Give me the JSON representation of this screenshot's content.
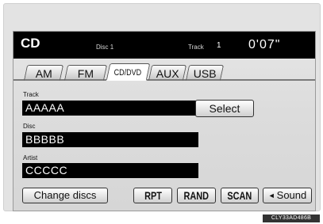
{
  "header": {
    "source": "CD",
    "disc_label": "Disc 1",
    "track_label": "Track",
    "track_number": "1",
    "elapsed_time": "0'07\""
  },
  "tabs": [
    {
      "label": "AM",
      "active": false
    },
    {
      "label": "FM",
      "active": false
    },
    {
      "label": "CD/DVD",
      "active": true
    },
    {
      "label": "AUX",
      "active": false
    },
    {
      "label": "USB",
      "active": false
    }
  ],
  "fields": {
    "track": {
      "label": "Track",
      "value": "AAAAA"
    },
    "disc": {
      "label": "Disc",
      "value": "BBBBB"
    },
    "artist": {
      "label": "Artist",
      "value": "CCCCC"
    }
  },
  "buttons": {
    "select": "Select",
    "change_discs": "Change discs",
    "rpt": "RPT",
    "rand": "RAND",
    "scan": "SCAN",
    "sound": "Sound",
    "sound_icon": "speaker-icon"
  },
  "figure_code": "CLY33AD486B",
  "colors": {
    "header_bg": "#000000",
    "field_bg": "#000000",
    "screen_bg": "#dcdcdc"
  }
}
